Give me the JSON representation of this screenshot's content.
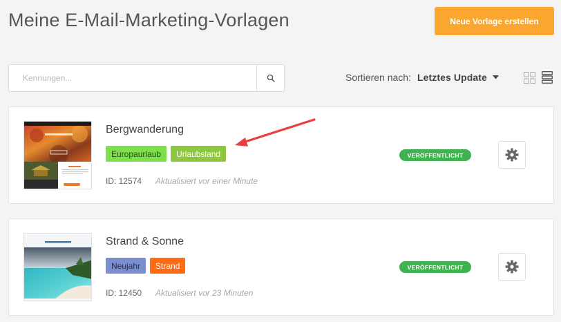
{
  "header": {
    "title": "Meine E-Mail-Marketing-Vorlagen",
    "new_button_label": "Neue Vorlage erstellen"
  },
  "search": {
    "placeholder": "Kennungen..."
  },
  "sort": {
    "label": "Sortieren nach:",
    "value": "Letztes Update"
  },
  "colors": {
    "accent": "#fba72f",
    "status_published": "#3fb34f",
    "tag_green": "#7be04a",
    "tag_olive": "#8dc63f",
    "tag_blue": "#7b8fd0",
    "tag_orange": "#ff6a13",
    "annotation_arrow": "#e8403f"
  },
  "templates": [
    {
      "title": "Bergwanderung",
      "tags": [
        "Europaurlaub",
        "Urlaubsland"
      ],
      "id_text": "ID: 12574",
      "updated": "Aktualisiert vor einer Minute",
      "status": "VERÖFFENTLICHT"
    },
    {
      "title": "Strand & Sonne",
      "tags": [
        "Neujahr",
        "Strand"
      ],
      "id_text": "ID: 12450",
      "updated": "Aktualisiert vor 23 Minuten",
      "status": "VERÖFFENTLICHT"
    }
  ],
  "icons": {
    "search": "search-icon",
    "sort_caret": "caret-down-icon",
    "grid_view": "grid-view-icon",
    "list_view": "list-view-icon",
    "settings": "gear-icon"
  }
}
